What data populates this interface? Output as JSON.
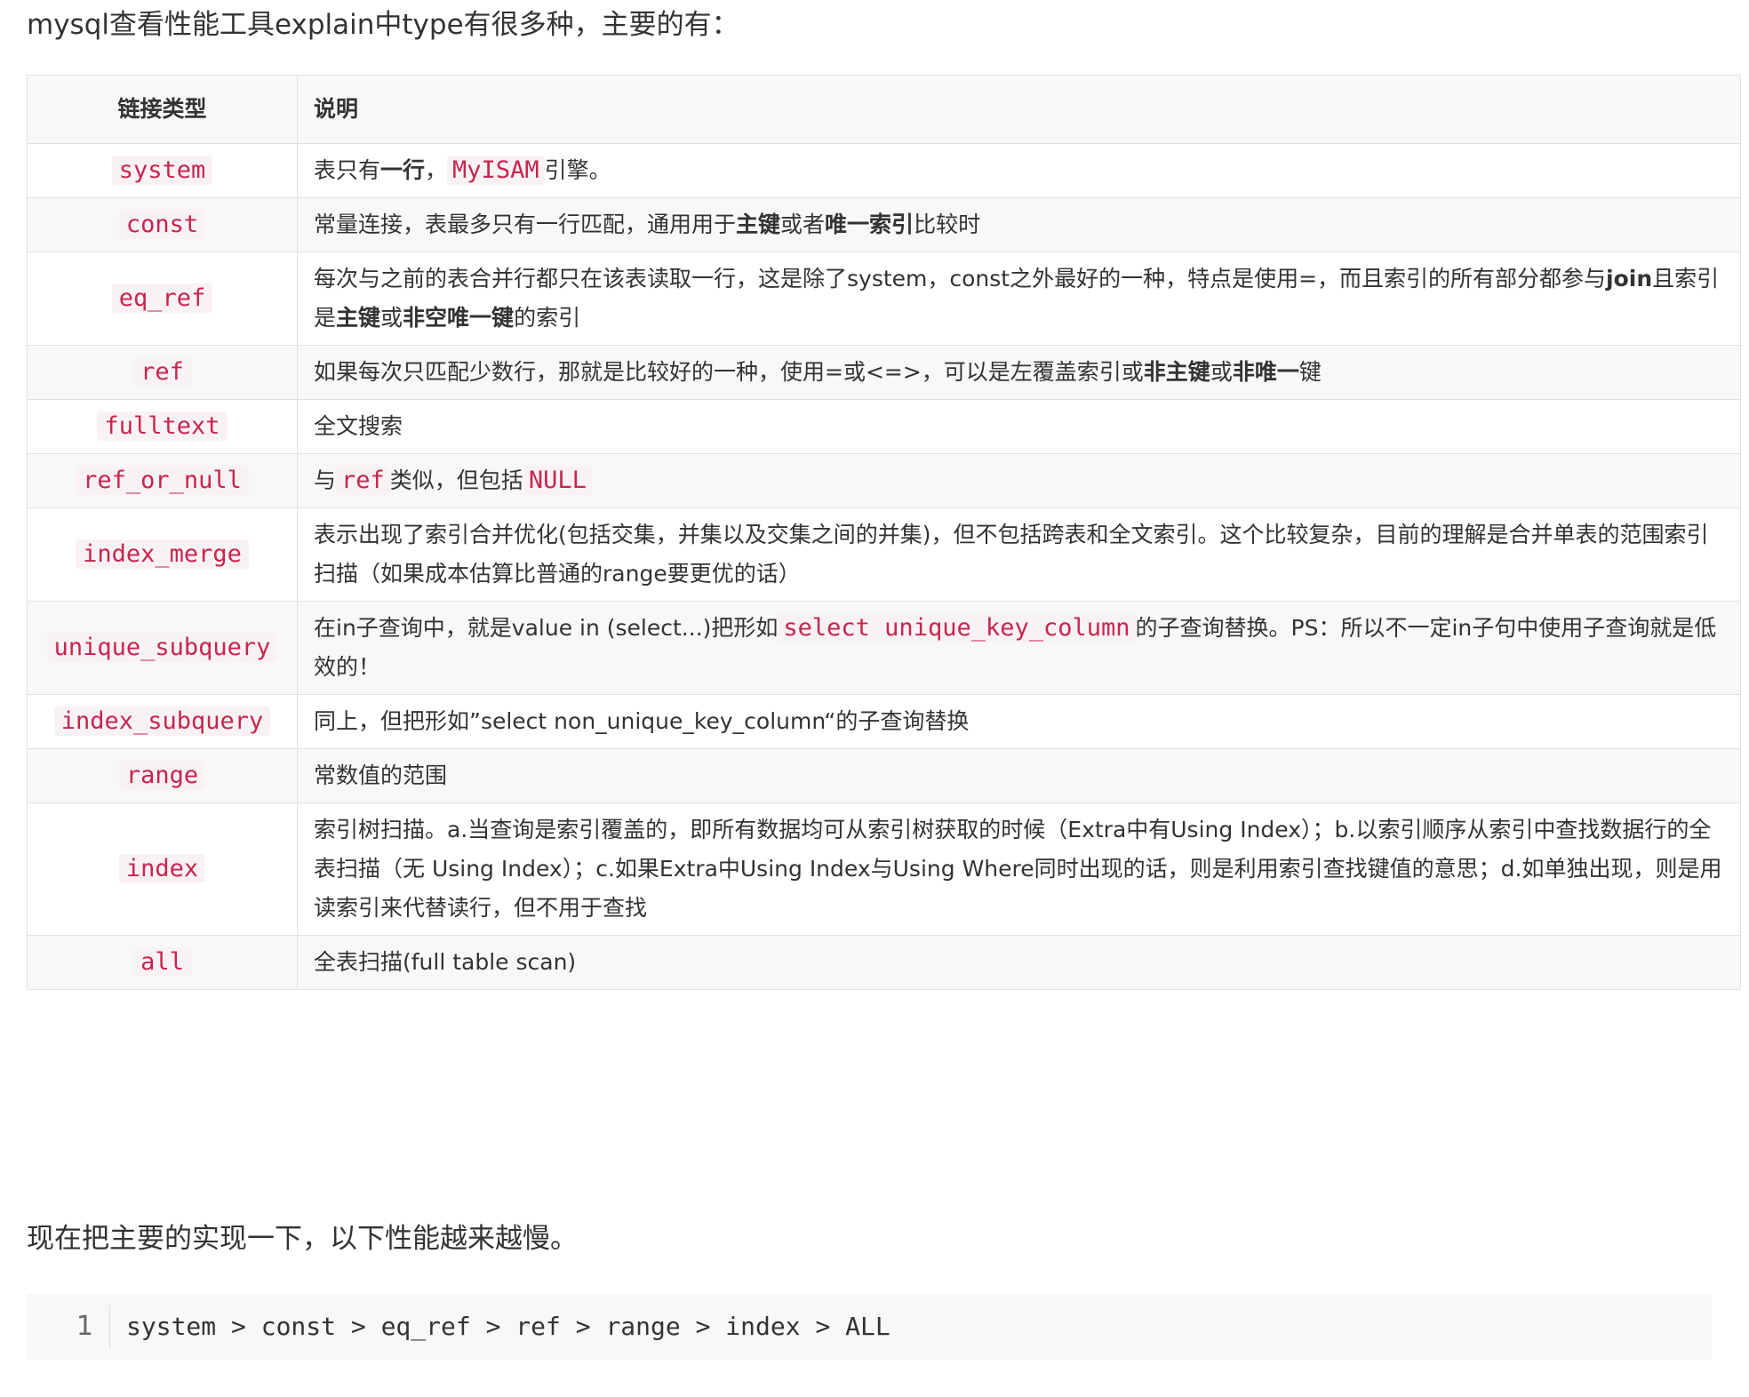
{
  "intro": "mysql查看性能工具explain中type有很多种，主要的有：",
  "table": {
    "headers": [
      "链接类型",
      "说明"
    ],
    "rows": [
      {
        "type": "system",
        "desc": [
          {
            "t": "表只有"
          },
          {
            "t": "一行",
            "b": true
          },
          {
            "t": "，"
          },
          {
            "t": "MyISAM",
            "code": true
          },
          {
            "t": "引擎。"
          }
        ]
      },
      {
        "type": "const",
        "desc": [
          {
            "t": "常量连接，表最多只有一行匹配，通用用于"
          },
          {
            "t": "主键",
            "b": true
          },
          {
            "t": "或者"
          },
          {
            "t": "唯一索引",
            "b": true
          },
          {
            "t": "比较时"
          }
        ]
      },
      {
        "type": "eq_ref",
        "desc": [
          {
            "t": "每次与之前的表合并行都只在该表读取一行，这是除了system，const之外最好的一种，特点是使用=，而且索引的所有部分都参与"
          },
          {
            "t": "join",
            "b": true
          },
          {
            "t": "且索引是"
          },
          {
            "t": "主键",
            "b": true
          },
          {
            "t": "或"
          },
          {
            "t": "非空唯一键",
            "b": true
          },
          {
            "t": "的索引"
          }
        ]
      },
      {
        "type": "ref",
        "desc": [
          {
            "t": "如果每次只匹配少数行，那就是比较好的一种，使用=或<=>，可以是左覆盖索引或"
          },
          {
            "t": "非主键",
            "b": true
          },
          {
            "t": "或"
          },
          {
            "t": "非唯一",
            "b": true
          },
          {
            "t": "键"
          }
        ]
      },
      {
        "type": "fulltext",
        "desc": [
          {
            "t": "全文搜索"
          }
        ]
      },
      {
        "type": "ref_or_null",
        "desc": [
          {
            "t": "与"
          },
          {
            "t": "ref",
            "code": true
          },
          {
            "t": "类似，但包括"
          },
          {
            "t": "NULL",
            "code": true
          }
        ]
      },
      {
        "type": "index_merge",
        "desc": [
          {
            "t": "表示出现了索引合并优化(包括交集，并集以及交集之间的并集)，但不包括跨表和全文索引。这个比较复杂，目前的理解是合并单表的范围索引扫描（如果成本估算比普通的range要更优的话）"
          }
        ]
      },
      {
        "type": "unique_subquery",
        "desc": [
          {
            "t": "在in子查询中，就是value in (select...)把形如"
          },
          {
            "t": "select unique_key_column",
            "code": true
          },
          {
            "t": "的子查询替换。PS：所以不一定in子句中使用子查询就是低效的！"
          }
        ]
      },
      {
        "type": "index_subquery",
        "desc": [
          {
            "t": "同上，但把形如”select non_unique_key_column“的子查询替换"
          }
        ]
      },
      {
        "type": "range",
        "desc": [
          {
            "t": "常数值的范围"
          }
        ]
      },
      {
        "type": "index",
        "desc": [
          {
            "t": "索引树扫描。a.当查询是索引覆盖的，即所有数据均可从索引树获取的时候（Extra中有Using Index）；b.以索引顺序从索引中查找数据行的全表扫描（无 Using Index）；c.如果Extra中Using Index与Using Where同时出现的话，则是利用索引查找键值的意思；d.如单独出现，则是用读索引来代替读行，但不用于查找"
          }
        ]
      },
      {
        "type": "all",
        "desc": [
          {
            "t": "全表扫描(full table scan)"
          }
        ]
      }
    ]
  },
  "summary": "现在把主要的实现一下，以下性能越来越慢。",
  "code": {
    "line_number": "1",
    "line": "system > const > eq_ref > ref > range > index > ALL"
  }
}
